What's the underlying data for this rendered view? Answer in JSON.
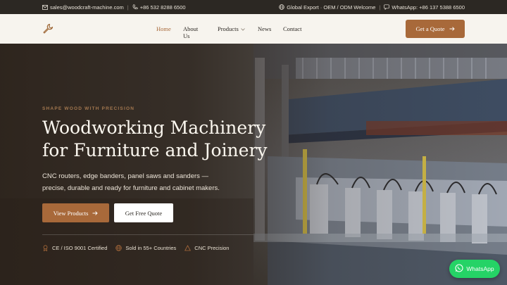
{
  "topbar": {
    "email": "sales@woodcraft-machine.com",
    "phone": "+86 532 8288 6500",
    "export": "Global Export · OEM / ODM Welcome",
    "whatsapp": "WhatsApp: +86 137 5388 6500"
  },
  "nav": {
    "items": [
      {
        "label": "Home"
      },
      {
        "label": "About Us"
      },
      {
        "label": "Products"
      },
      {
        "label": "News"
      },
      {
        "label": "Contact"
      }
    ],
    "cta": "Get a Quote"
  },
  "hero": {
    "eyebrow": "SHAPE WOOD WITH PRECISION",
    "headline_line1": "Woodworking Machinery",
    "headline_line2": "for Furniture and Joinery",
    "subtext_line1": "CNC routers, edge banders, panel saws and sanders —",
    "subtext_line2": "precise, durable and ready for furniture and cabinet makers.",
    "primary_button": "View Products",
    "secondary_button": "Get Free Quote",
    "badges": [
      {
        "label": "CE / ISO 9001 Certified"
      },
      {
        "label": "Sold in 55+ Countries"
      },
      {
        "label": "CNC Precision"
      }
    ]
  },
  "whatsapp_button": "WhatsApp",
  "colors": {
    "accent": "#a8693a",
    "topbar_bg": "#2c2823",
    "header_bg": "#f7f4ee",
    "whatsapp": "#25d366"
  }
}
